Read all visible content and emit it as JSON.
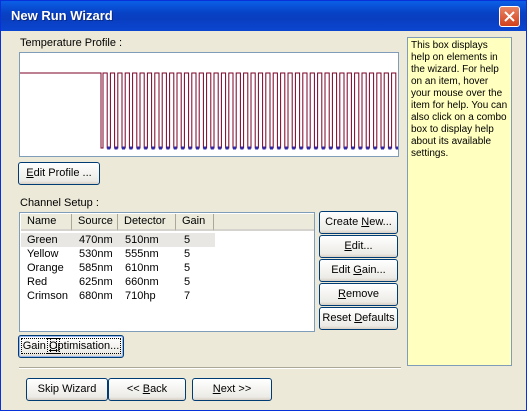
{
  "window": {
    "title": "New Run Wizard"
  },
  "profile": {
    "label": "Temperature Profile :",
    "edit_button": "Edit Profile ...",
    "edit_button_accel": "E",
    "edit_button_rest": "dit Profile ...",
    "cycles": 40
  },
  "channels": {
    "label": "Channel Setup :",
    "columns": [
      "Name",
      "Source",
      "Detector",
      "Gain"
    ],
    "rows": [
      {
        "name": "Green",
        "source": "470nm",
        "detector": "510nm",
        "gain": "5"
      },
      {
        "name": "Yellow",
        "source": "530nm",
        "detector": "555nm",
        "gain": "5"
      },
      {
        "name": "Orange",
        "source": "585nm",
        "detector": "610nm",
        "gain": "5"
      },
      {
        "name": "Red",
        "source": "625nm",
        "detector": "660nm",
        "gain": "5"
      },
      {
        "name": "Crimson",
        "source": "680nm",
        "detector": "710hp",
        "gain": "7"
      }
    ],
    "create_new": {
      "pre": "Create ",
      "accel": "N",
      "post": "ew..."
    },
    "edit": {
      "pre": "",
      "accel": "E",
      "post": "dit..."
    },
    "edit_gain": {
      "pre": "Edit ",
      "accel": "G",
      "post": "ain..."
    },
    "remove": {
      "pre": "",
      "accel": "R",
      "post": "emove"
    },
    "reset_defaults": {
      "pre": "Reset ",
      "accel": "D",
      "post": "efaults"
    },
    "gain_optimisation": {
      "pre": "Gain ",
      "accel": "O",
      "post": "ptimisation..."
    }
  },
  "help": {
    "text": "This box displays help on elements in the wizard. For help on an item, hover your mouse over the item for help. You can also click on a combo box to display help about its available settings."
  },
  "nav": {
    "skip": "Skip Wizard",
    "back": {
      "pre": "<< ",
      "accel": "B",
      "post": "ack"
    },
    "next": {
      "pre": "",
      "accel": "N",
      "post": "ext >>"
    }
  },
  "colors": {
    "profile_line": "#7a0026",
    "profile_dot": "#2b2bb0",
    "help_bg": "#ffffc0"
  }
}
